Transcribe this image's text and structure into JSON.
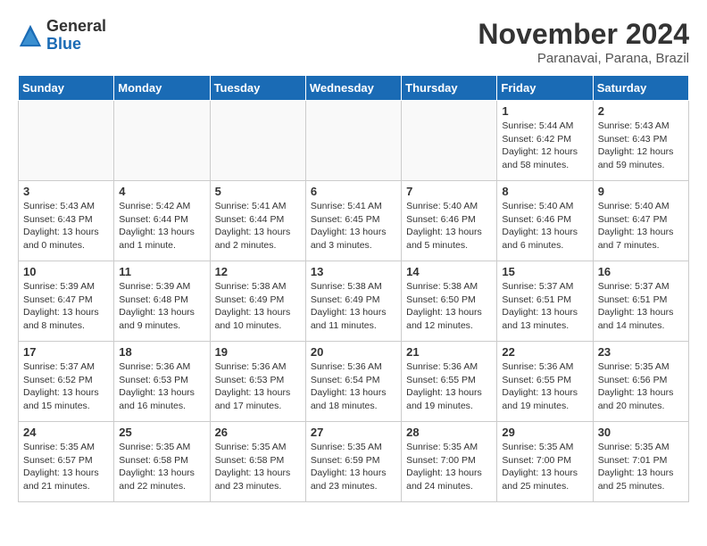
{
  "header": {
    "logo_general": "General",
    "logo_blue": "Blue",
    "month_title": "November 2024",
    "subtitle": "Paranavai, Parana, Brazil"
  },
  "days_of_week": [
    "Sunday",
    "Monday",
    "Tuesday",
    "Wednesday",
    "Thursday",
    "Friday",
    "Saturday"
  ],
  "weeks": [
    [
      {
        "day": "",
        "empty": true
      },
      {
        "day": "",
        "empty": true
      },
      {
        "day": "",
        "empty": true
      },
      {
        "day": "",
        "empty": true
      },
      {
        "day": "",
        "empty": true
      },
      {
        "day": "1",
        "sunrise": "5:44 AM",
        "sunset": "6:42 PM",
        "daylight": "12 hours and 58 minutes."
      },
      {
        "day": "2",
        "sunrise": "5:43 AM",
        "sunset": "6:43 PM",
        "daylight": "12 hours and 59 minutes."
      }
    ],
    [
      {
        "day": "3",
        "sunrise": "5:43 AM",
        "sunset": "6:43 PM",
        "daylight": "13 hours and 0 minutes."
      },
      {
        "day": "4",
        "sunrise": "5:42 AM",
        "sunset": "6:44 PM",
        "daylight": "13 hours and 1 minute."
      },
      {
        "day": "5",
        "sunrise": "5:41 AM",
        "sunset": "6:44 PM",
        "daylight": "13 hours and 2 minutes."
      },
      {
        "day": "6",
        "sunrise": "5:41 AM",
        "sunset": "6:45 PM",
        "daylight": "13 hours and 3 minutes."
      },
      {
        "day": "7",
        "sunrise": "5:40 AM",
        "sunset": "6:46 PM",
        "daylight": "13 hours and 5 minutes."
      },
      {
        "day": "8",
        "sunrise": "5:40 AM",
        "sunset": "6:46 PM",
        "daylight": "13 hours and 6 minutes."
      },
      {
        "day": "9",
        "sunrise": "5:40 AM",
        "sunset": "6:47 PM",
        "daylight": "13 hours and 7 minutes."
      }
    ],
    [
      {
        "day": "10",
        "sunrise": "5:39 AM",
        "sunset": "6:47 PM",
        "daylight": "13 hours and 8 minutes."
      },
      {
        "day": "11",
        "sunrise": "5:39 AM",
        "sunset": "6:48 PM",
        "daylight": "13 hours and 9 minutes."
      },
      {
        "day": "12",
        "sunrise": "5:38 AM",
        "sunset": "6:49 PM",
        "daylight": "13 hours and 10 minutes."
      },
      {
        "day": "13",
        "sunrise": "5:38 AM",
        "sunset": "6:49 PM",
        "daylight": "13 hours and 11 minutes."
      },
      {
        "day": "14",
        "sunrise": "5:38 AM",
        "sunset": "6:50 PM",
        "daylight": "13 hours and 12 minutes."
      },
      {
        "day": "15",
        "sunrise": "5:37 AM",
        "sunset": "6:51 PM",
        "daylight": "13 hours and 13 minutes."
      },
      {
        "day": "16",
        "sunrise": "5:37 AM",
        "sunset": "6:51 PM",
        "daylight": "13 hours and 14 minutes."
      }
    ],
    [
      {
        "day": "17",
        "sunrise": "5:37 AM",
        "sunset": "6:52 PM",
        "daylight": "13 hours and 15 minutes."
      },
      {
        "day": "18",
        "sunrise": "5:36 AM",
        "sunset": "6:53 PM",
        "daylight": "13 hours and 16 minutes."
      },
      {
        "day": "19",
        "sunrise": "5:36 AM",
        "sunset": "6:53 PM",
        "daylight": "13 hours and 17 minutes."
      },
      {
        "day": "20",
        "sunrise": "5:36 AM",
        "sunset": "6:54 PM",
        "daylight": "13 hours and 18 minutes."
      },
      {
        "day": "21",
        "sunrise": "5:36 AM",
        "sunset": "6:55 PM",
        "daylight": "13 hours and 19 minutes."
      },
      {
        "day": "22",
        "sunrise": "5:36 AM",
        "sunset": "6:55 PM",
        "daylight": "13 hours and 19 minutes."
      },
      {
        "day": "23",
        "sunrise": "5:35 AM",
        "sunset": "6:56 PM",
        "daylight": "13 hours and 20 minutes."
      }
    ],
    [
      {
        "day": "24",
        "sunrise": "5:35 AM",
        "sunset": "6:57 PM",
        "daylight": "13 hours and 21 minutes."
      },
      {
        "day": "25",
        "sunrise": "5:35 AM",
        "sunset": "6:58 PM",
        "daylight": "13 hours and 22 minutes."
      },
      {
        "day": "26",
        "sunrise": "5:35 AM",
        "sunset": "6:58 PM",
        "daylight": "13 hours and 23 minutes."
      },
      {
        "day": "27",
        "sunrise": "5:35 AM",
        "sunset": "6:59 PM",
        "daylight": "13 hours and 23 minutes."
      },
      {
        "day": "28",
        "sunrise": "5:35 AM",
        "sunset": "7:00 PM",
        "daylight": "13 hours and 24 minutes."
      },
      {
        "day": "29",
        "sunrise": "5:35 AM",
        "sunset": "7:00 PM",
        "daylight": "13 hours and 25 minutes."
      },
      {
        "day": "30",
        "sunrise": "5:35 AM",
        "sunset": "7:01 PM",
        "daylight": "13 hours and 25 minutes."
      }
    ]
  ],
  "labels": {
    "sunrise": "Sunrise:",
    "sunset": "Sunset:",
    "daylight": "Daylight:"
  }
}
